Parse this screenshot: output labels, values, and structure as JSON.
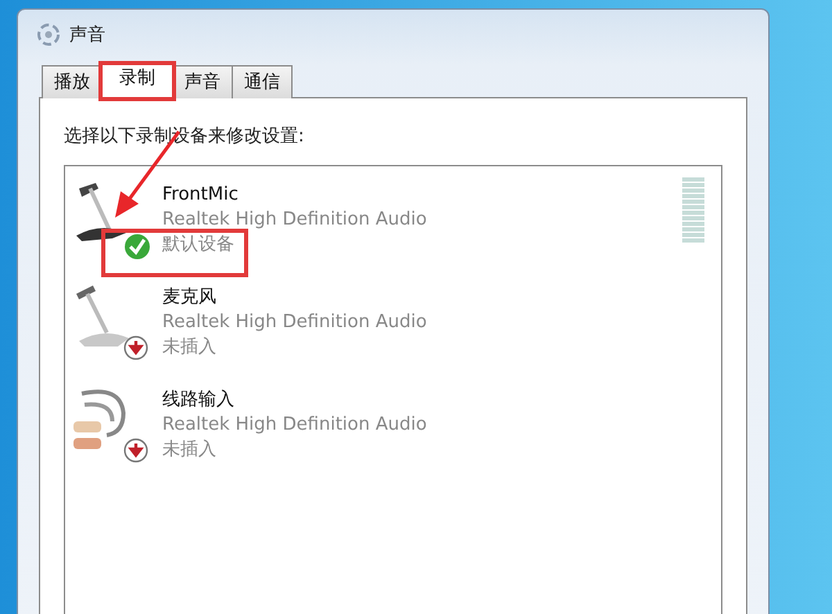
{
  "window": {
    "title": "声音"
  },
  "tabs": [
    {
      "label": "播放",
      "selected": false,
      "highlighted": false
    },
    {
      "label": "录制",
      "selected": true,
      "highlighted": true
    },
    {
      "label": "声音",
      "selected": false,
      "highlighted": false
    },
    {
      "label": "通信",
      "selected": false,
      "highlighted": false
    }
  ],
  "instruction": "选择以下录制设备来修改设置:",
  "devices": [
    {
      "name": "FrontMic",
      "driver": "Realtek High Definition Audio",
      "status": "默认设备",
      "kind": "default",
      "meter": true,
      "highlighted": true
    },
    {
      "name": "麦克风",
      "driver": "Realtek High Definition Audio",
      "status": "未插入",
      "kind": "unplugged",
      "meter": false,
      "highlighted": false
    },
    {
      "name": "线路输入",
      "driver": "Realtek High Definition Audio",
      "status": "未插入",
      "kind": "unplugged",
      "meter": false,
      "highlighted": false
    }
  ]
}
